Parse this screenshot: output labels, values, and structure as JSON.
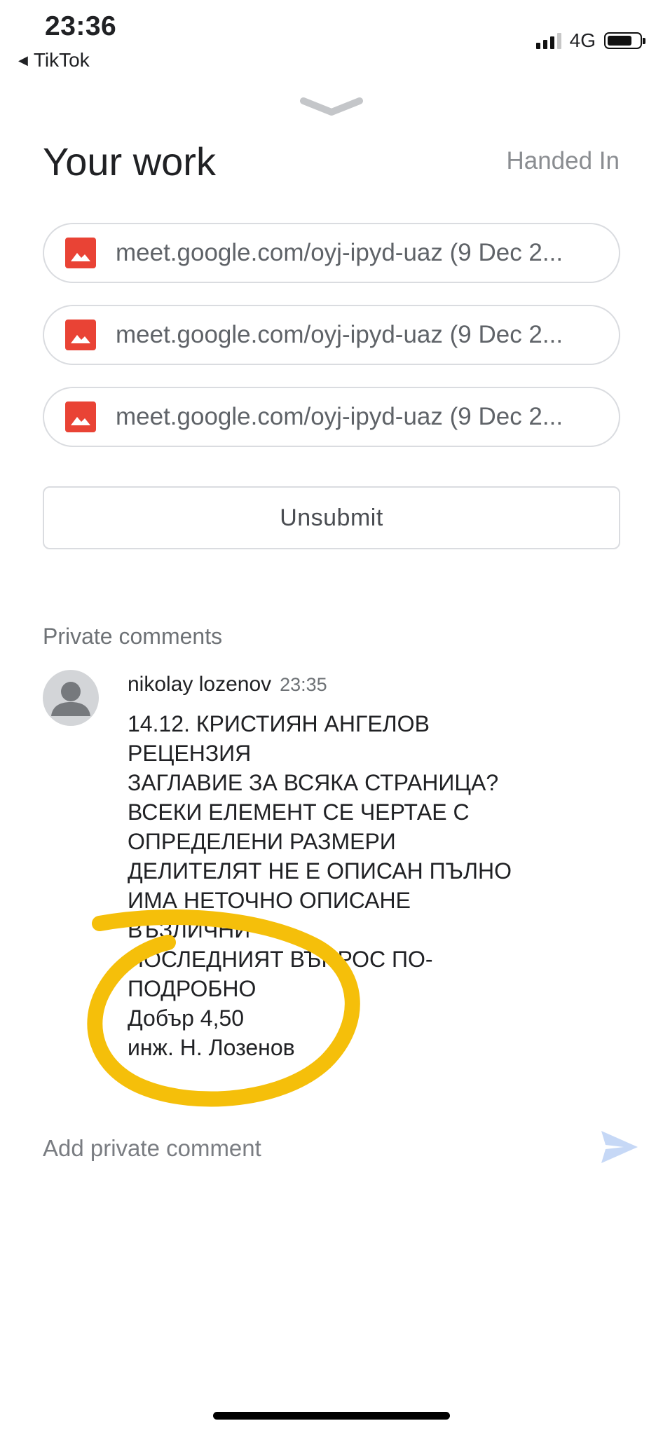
{
  "status_bar": {
    "time": "23:36",
    "back_app": "TikTok",
    "network": "4G",
    "battery_level": 0.8
  },
  "header": {
    "title": "Your work",
    "status": "Handed In"
  },
  "attachments": [
    {
      "label": "meet.google.com/oyj-ipyd-uaz (9 Dec 2...",
      "icon": "image-icon"
    },
    {
      "label": "meet.google.com/oyj-ipyd-uaz (9 Dec 2...",
      "icon": "image-icon"
    },
    {
      "label": "meet.google.com/oyj-ipyd-uaz (9 Dec 2...",
      "icon": "image-icon"
    }
  ],
  "actions": {
    "unsubmit_label": "Unsubmit"
  },
  "private_comments": {
    "section_title": "Private comments",
    "comments": [
      {
        "author": "nikolay lozenov",
        "time": "23:35",
        "lines": [
          "14.12. КРИСТИЯН АНГЕЛОВ",
          "РЕЦЕНЗИЯ",
          "ЗАГЛАВИЕ ЗА ВСЯКА СТРАНИЦА?",
          "ВСЕКИ ЕЛЕМЕНТ СЕ ЧЕРТАЕ С",
          "ОПРЕДЕЛЕНИ РАЗМЕРИ",
          "ДЕЛИТЕЛЯТ НЕ Е ОПИСАН ПЪЛНО",
          "ИМА НЕТОЧНО ОПИСАНЕ",
          "ВЪЗЛИЧНИ",
          "ПОСЛЕДНИЯТ ВЪПРОС ПО-",
          "ПОДРОБНО",
          "Добър 4,50",
          "инж. Н. Лозенов"
        ]
      }
    ]
  },
  "composer": {
    "placeholder": "Add private comment"
  },
  "colors": {
    "attachment_icon": "#e94335",
    "highlight": "#f5bf0a",
    "send_icon": "#c6d8f6",
    "border": "#dadce0"
  }
}
